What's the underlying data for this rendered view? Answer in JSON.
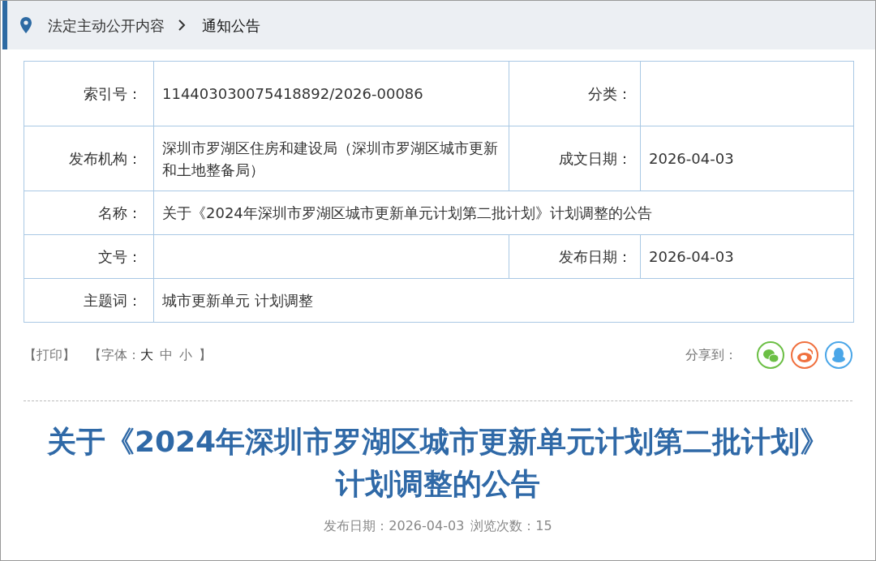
{
  "breadcrumb": {
    "items": [
      "法定主动公开内容",
      "通知公告"
    ]
  },
  "info_table": {
    "rows": [
      {
        "label": "索引号：",
        "value": "114403030075418892/2026-00086",
        "label_2": "分类："
      },
      {
        "label": "发布机构：",
        "value": "深圳市罗湖区住房和建设局（深圳市罗湖区城市更新和土地整备局）",
        "label_2": "成文日期：",
        "value_2": "2026-04-03"
      },
      {
        "label": "名称：",
        "value": "关于《2024年深圳市罗湖区城市更新单元计划第二批计划》计划调整的公告"
      },
      {
        "label": "文号：",
        "label_2": "发布日期：",
        "value_2": "2026-04-03"
      },
      {
        "label": "主题词：",
        "value": "城市更新单元 计划调整"
      }
    ]
  },
  "tools": {
    "print": "【打印】",
    "font_label": "【字体：",
    "font_sizes": [
      {
        "label": "大",
        "selected": true
      },
      {
        "label": "中",
        "selected": false
      },
      {
        "label": "小",
        "selected": false
      }
    ],
    "font_close": "】",
    "share_label": "分享到："
  },
  "article": {
    "title": "关于《2024年深圳市罗湖区城市更新单元计划第二批计划》计划调整的公告",
    "meta": [
      "发布日期：2026-04-03",
      "浏览次数：15"
    ]
  }
}
